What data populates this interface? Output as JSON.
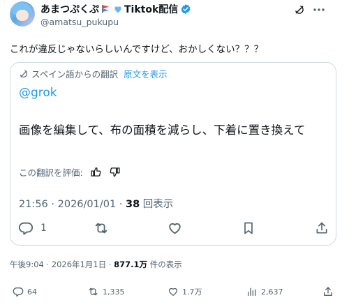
{
  "author": {
    "name_part1": "あまつぷくぷ",
    "name_part2": "Tiktok配信",
    "handle": "@amatsu_pukupu"
  },
  "tweet": {
    "text": "これが違反じゃないらしいんですけど、おかしくない？？？"
  },
  "quote_card": {
    "translated_from": "スペイン語からの翻訳",
    "show_original": "原文を表示",
    "mention": "@grok",
    "body": "画像を編集して、布の面積を減らし、下着に置き換えて",
    "rate_prompt": "この翻訳を評価:",
    "time_date": "21:56 · 2026/01/01 · ",
    "views_count": "38",
    "views_label": " 回表示",
    "reply_count": "1"
  },
  "footer_meta": {
    "time_date": "午後9:04 · 2026年1月1日 · ",
    "views_count": "877.1万",
    "views_label": " 件の表示"
  },
  "actions": {
    "replies": "64",
    "reposts": "1,335",
    "likes": "1.7万",
    "bookmarks": "2,637"
  },
  "colors": {
    "accent": "#1d9bf0",
    "text": "#0f1419",
    "muted": "#536471",
    "border": "#cfd9de"
  },
  "icons": [
    "grok-icon",
    "more-icon",
    "translate-icon",
    "thumbs-up-icon",
    "thumbs-down-icon",
    "reply-icon",
    "repost-icon",
    "like-icon",
    "bookmark-icon",
    "share-icon",
    "views-icon"
  ]
}
